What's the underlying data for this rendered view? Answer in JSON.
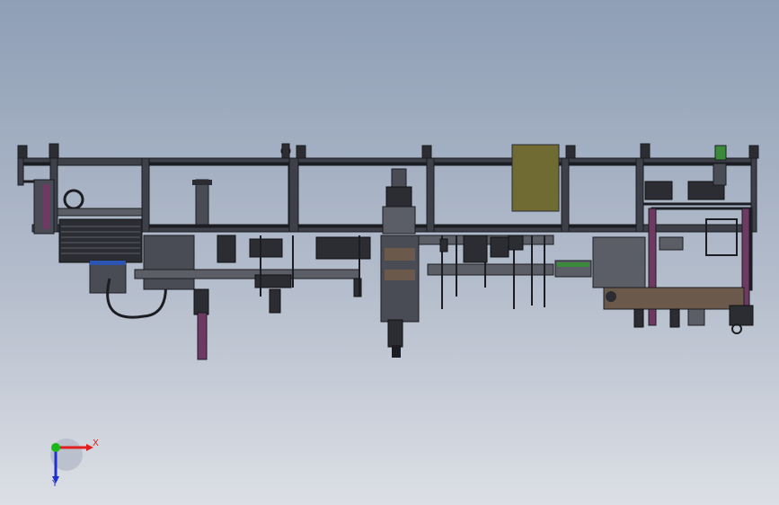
{
  "triad": {
    "x_label": "X",
    "y_label": "Y",
    "x_color": "#e02020",
    "y_color": "#1f2fd0",
    "z_color": "#18b818"
  },
  "colors": {
    "frame": "#3d4048",
    "frame_edge": "#1c1d22",
    "steel": "#5b5e66",
    "dark": "#2b2d33",
    "olive": "#6f6b32",
    "purple": "#6e3a63",
    "bronze": "#6b5a4c",
    "green": "#3b8a3b",
    "blue": "#2b55b0"
  }
}
